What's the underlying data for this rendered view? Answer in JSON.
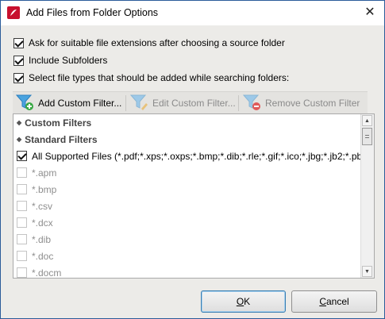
{
  "window": {
    "title": "Add Files from Folder Options",
    "close_glyph": "✕"
  },
  "options": [
    {
      "label": "Ask for suitable file extensions after choosing a source folder",
      "checked": true
    },
    {
      "label": "Include Subfolders",
      "checked": true
    },
    {
      "label": "Select file types that should be added while searching folders:",
      "checked": true
    }
  ],
  "toolbar": {
    "add_label": "Add Custom Filter...",
    "edit_label": "Edit Custom Filter...",
    "remove_label": "Remove Custom Filter",
    "icons": {
      "add": "funnel-add-icon",
      "edit": "funnel-edit-icon",
      "remove": "funnel-remove-icon"
    }
  },
  "list": {
    "groups": {
      "custom": "Custom Filters",
      "standard": "Standard Filters"
    },
    "group_glyph": "◆",
    "items": [
      {
        "label": "All Supported Files (*.pdf;*.xps;*.oxps;*.bmp;*.dib;*.rle;*.gif;*.ico;*.jbg;*.jb2;*.pb",
        "checked": true,
        "enabled": true
      },
      {
        "label": "*.apm",
        "checked": false,
        "enabled": false
      },
      {
        "label": "*.bmp",
        "checked": false,
        "enabled": false
      },
      {
        "label": "*.csv",
        "checked": false,
        "enabled": false
      },
      {
        "label": "*.dcx",
        "checked": false,
        "enabled": false
      },
      {
        "label": "*.dib",
        "checked": false,
        "enabled": false
      },
      {
        "label": "*.doc",
        "checked": false,
        "enabled": false
      },
      {
        "label": "*.docm",
        "checked": false,
        "enabled": false
      }
    ]
  },
  "buttons": {
    "ok": {
      "mnemonic": "O",
      "rest": "K"
    },
    "cancel": {
      "mnemonic": "C",
      "rest": "ancel"
    }
  },
  "colors": {
    "accent": "#3c7fb1",
    "app_icon": "#c8102e",
    "funnel": "#4aa3df",
    "funnel_disabled": "#9dc9e8",
    "add_badge": "#39a845",
    "remove_badge": "#e05a5a"
  }
}
